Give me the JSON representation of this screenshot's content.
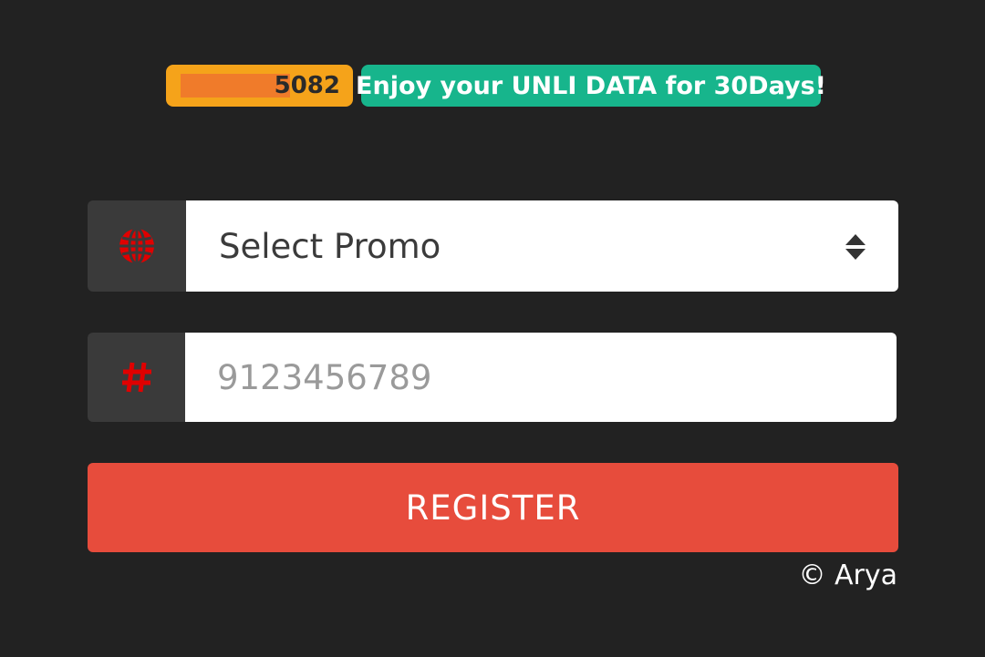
{
  "badges": {
    "number_visible": "5082",
    "promo_text": "Enjoy your UNLI DATA for 30Days!"
  },
  "promo_select": {
    "value": "Select Promo",
    "icon": "globe-icon"
  },
  "number_input": {
    "placeholder": "9123456789",
    "value": "",
    "icon": "hash-icon"
  },
  "register_button": {
    "label": "REGISTER"
  },
  "footer": {
    "copyright": "© Arya"
  },
  "colors": {
    "background": "#222222",
    "number_badge": "#f5a31a",
    "promo_badge": "#17b58c",
    "icon_red": "#e00000",
    "register": "#e74c3c"
  }
}
